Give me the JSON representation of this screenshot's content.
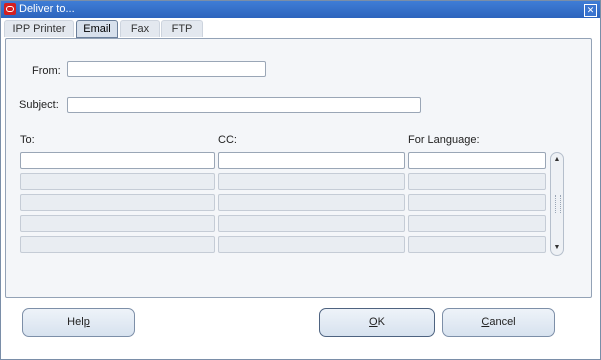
{
  "window": {
    "title": "Deliver to...",
    "close_glyph": "✕"
  },
  "tabs": [
    {
      "label": "IPP Printer",
      "active": false
    },
    {
      "label": "Email",
      "active": true
    },
    {
      "label": "Fax",
      "active": false
    },
    {
      "label": "FTP",
      "active": false
    }
  ],
  "form": {
    "from_label": "From:",
    "from_value": "",
    "subject_label": "Subject:",
    "subject_value": ""
  },
  "grid": {
    "columns": [
      "To:",
      "CC:",
      "For Language:"
    ],
    "rows": [
      [
        "",
        "",
        ""
      ],
      [
        "",
        "",
        ""
      ],
      [
        "",
        "",
        ""
      ],
      [
        "",
        "",
        ""
      ],
      [
        "",
        "",
        ""
      ]
    ]
  },
  "buttons": {
    "help": {
      "pre": "Hel",
      "mnemonic": "p",
      "post": ""
    },
    "ok": {
      "pre": "",
      "mnemonic": "O",
      "post": "K"
    },
    "cancel": {
      "pre": "",
      "mnemonic": "C",
      "post": "ancel"
    }
  },
  "colors": {
    "titlebar": "#2c64bd",
    "oracle_icon": "#d42020",
    "panel": "#f4f6f9"
  },
  "icons": {
    "app": "oracle-icon",
    "close": "close-icon",
    "scroll_up": "scroll-up-icon",
    "scroll_down": "scroll-down-icon"
  }
}
